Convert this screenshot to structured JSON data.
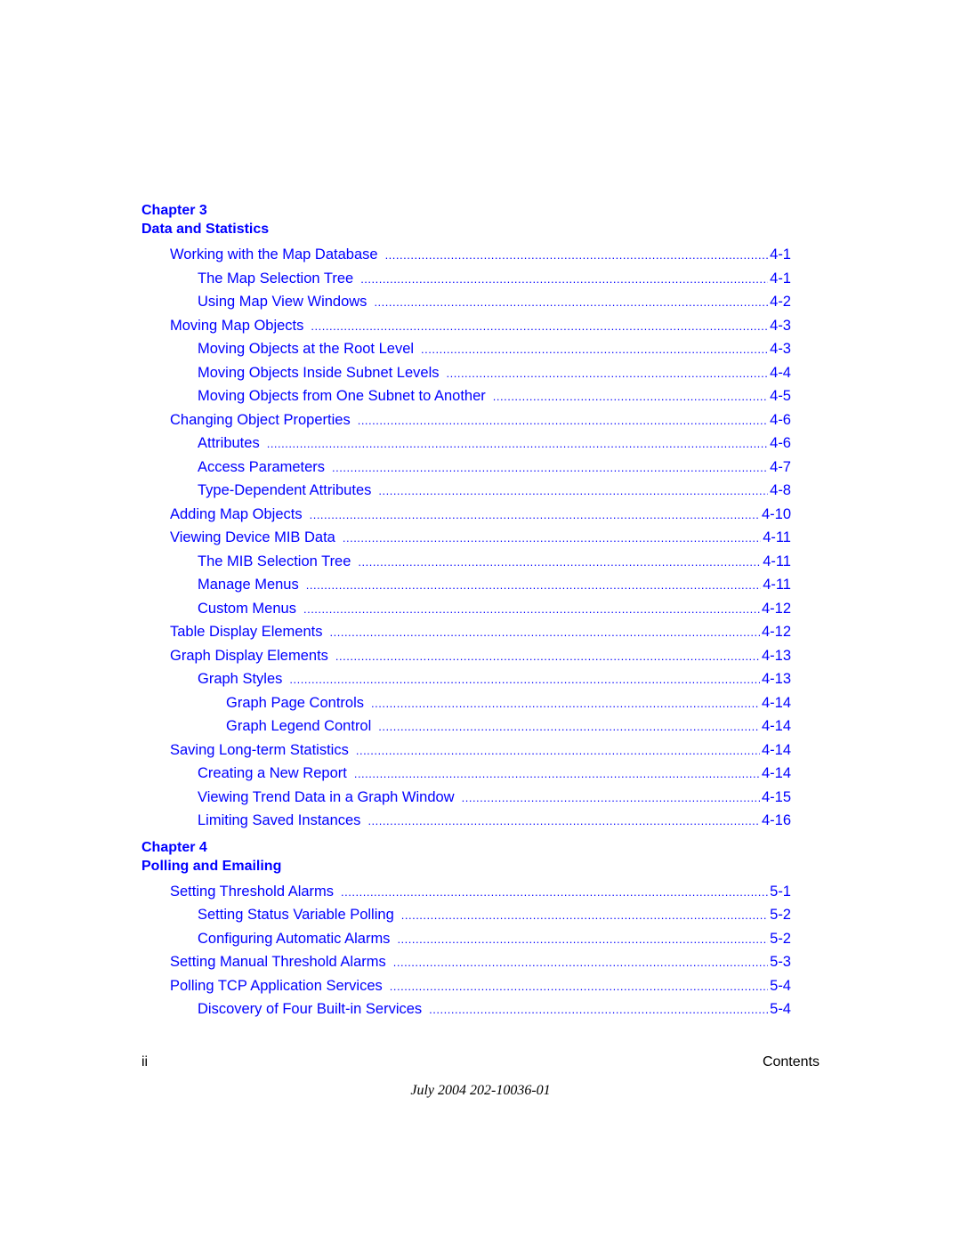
{
  "chapters": [
    {
      "label": "Chapter 3",
      "title": "Data and Statistics",
      "entries": [
        {
          "level": 1,
          "title": "Working with the Map Database",
          "page": "4-1"
        },
        {
          "level": 2,
          "title": "The Map Selection Tree",
          "page": "4-1"
        },
        {
          "level": 2,
          "title": "Using Map View Windows",
          "page": "4-2"
        },
        {
          "level": 1,
          "title": "Moving Map Objects",
          "page": "4-3"
        },
        {
          "level": 2,
          "title": "Moving Objects at the Root Level",
          "page": "4-3"
        },
        {
          "level": 2,
          "title": "Moving Objects Inside Subnet Levels",
          "page": "4-4"
        },
        {
          "level": 2,
          "title": "Moving Objects from One Subnet to Another",
          "page": "4-5"
        },
        {
          "level": 1,
          "title": "Changing Object Properties",
          "page": "4-6"
        },
        {
          "level": 2,
          "title": "Attributes",
          "page": "4-6"
        },
        {
          "level": 2,
          "title": "Access Parameters",
          "page": "4-7"
        },
        {
          "level": 2,
          "title": "Type-Dependent Attributes",
          "page": "4-8"
        },
        {
          "level": 1,
          "title": "Adding Map Objects",
          "page": "4-10"
        },
        {
          "level": 1,
          "title": "Viewing Device MIB Data",
          "page": "4-11"
        },
        {
          "level": 2,
          "title": "The MIB Selection Tree",
          "page": "4-11"
        },
        {
          "level": 2,
          "title": "Manage Menus",
          "page": "4-11"
        },
        {
          "level": 2,
          "title": "Custom Menus",
          "page": "4-12"
        },
        {
          "level": 1,
          "title": "Table Display Elements",
          "page": "4-12"
        },
        {
          "level": 1,
          "title": "Graph Display Elements",
          "page": "4-13"
        },
        {
          "level": 2,
          "title": "Graph Styles",
          "page": "4-13"
        },
        {
          "level": 3,
          "title": "Graph Page Controls",
          "page": "4-14"
        },
        {
          "level": 3,
          "title": "Graph Legend Control",
          "page": "4-14"
        },
        {
          "level": 1,
          "title": "Saving Long-term Statistics",
          "page": "4-14"
        },
        {
          "level": 2,
          "title": "Creating a New Report",
          "page": "4-14"
        },
        {
          "level": 2,
          "title": "Viewing Trend Data in a Graph Window",
          "page": "4-15"
        },
        {
          "level": 2,
          "title": "Limiting Saved Instances",
          "page": "4-16"
        }
      ]
    },
    {
      "label": "Chapter 4",
      "title": "Polling and Emailing",
      "entries": [
        {
          "level": 1,
          "title": "Setting Threshold Alarms",
          "page": "5-1"
        },
        {
          "level": 2,
          "title": "Setting Status Variable Polling",
          "page": "5-2"
        },
        {
          "level": 2,
          "title": "Configuring Automatic Alarms",
          "page": "5-2"
        },
        {
          "level": 1,
          "title": "Setting Manual Threshold Alarms",
          "page": "5-3"
        },
        {
          "level": 1,
          "title": "Polling TCP Application Services",
          "page": "5-4"
        },
        {
          "level": 2,
          "title": "Discovery of Four Built-in Services",
          "page": "5-4"
        }
      ]
    }
  ],
  "footer": {
    "page_number": "ii",
    "section": "Contents",
    "date_doc": "July 2004 202-10036-01"
  },
  "colors": {
    "link": "#0000ff",
    "text": "#000000"
  }
}
